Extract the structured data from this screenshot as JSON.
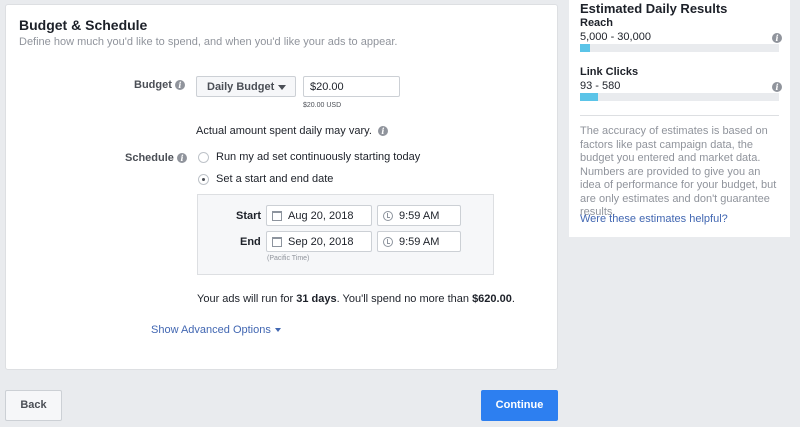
{
  "budget_schedule": {
    "title": "Budget & Schedule",
    "subtitle": "Define how much you'd like to spend, and when you'd like your ads to appear.",
    "budget_label": "Budget",
    "budget_type": "Daily Budget",
    "budget_amount": "$20.00",
    "budget_currency_hint": "$20.00 USD",
    "vary_note": "Actual amount spent daily may vary.",
    "schedule_label": "Schedule",
    "schedule_options": [
      {
        "label": "Run my ad set continuously starting today",
        "selected": false
      },
      {
        "label": "Set a start and end date",
        "selected": true
      }
    ],
    "start_label": "Start",
    "start_date": "Aug 20, 2018",
    "start_time": "9:59 AM",
    "end_label": "End",
    "end_date": "Sep 20, 2018",
    "end_time": "9:59 AM",
    "timezone_note": "(Pacific Time)",
    "summary_prefix": "Your ads will run for ",
    "summary_days": "31 days",
    "summary_middle": ". You'll spend no more than ",
    "summary_amount": "$620.00",
    "summary_suffix": ".",
    "advanced_link": "Show Advanced Options"
  },
  "footer": {
    "back_label": "Back",
    "continue_label": "Continue"
  },
  "estimates": {
    "title": "Estimated Daily Results",
    "metrics": [
      {
        "label": "Reach",
        "range": "5,000 - 30,000",
        "level": 0.05
      },
      {
        "label": "Link Clicks",
        "range": "93 - 580",
        "level": 0.09
      }
    ],
    "note": "The accuracy of estimates is based on factors like past campaign data, the budget you entered and market data. Numbers are provided to give you an idea of performance for your budget, but are only estimates and don't guarantee results.",
    "helpful_link": "Were these estimates helpful?"
  },
  "colors": {
    "primary_button": "#2d7ff0",
    "link": "#4267b2",
    "estimate_bar": "#5bc4e8"
  }
}
